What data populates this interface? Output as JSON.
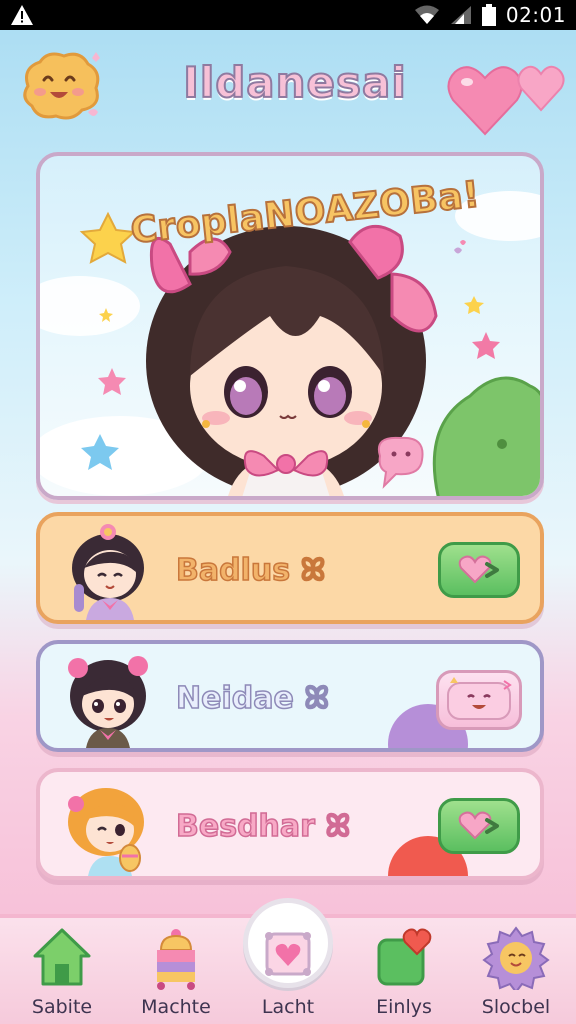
{
  "status_bar": {
    "warning_icon": "warning-triangle-icon",
    "wifi_icon": "wifi-icon",
    "signal_icon": "signal-icon",
    "battery_icon": "battery-icon",
    "time": "02:01"
  },
  "header": {
    "title": "Ildanesai",
    "mascot_icon": "smiling-cookie-icon",
    "hearts_icon": "hearts-icon"
  },
  "hero": {
    "title": "CroplaNOAZOBa!",
    "character": "chibi-girl-with-pink-bows"
  },
  "characters": [
    {
      "name": "Badlus ꕤ",
      "avatar": "chibi-girl-dark-hair-bun",
      "action_icon": "heart-arrow-icon"
    },
    {
      "name": "Neidae ꕤ",
      "avatar": "chibi-girl-pink-bows",
      "action_icon": "happy-pillow-icon"
    },
    {
      "name": "Besdhar ꕤ",
      "avatar": "chibi-girl-orange-hair",
      "action_icon": "heart-arrow-icon"
    }
  ],
  "nav": {
    "items": [
      {
        "label": "Sabite",
        "icon": "home-icon"
      },
      {
        "label": "Machte",
        "icon": "bell-cake-icon"
      },
      {
        "label": "Lacht",
        "icon": "heart-pillow-icon"
      },
      {
        "label": "Einlys",
        "icon": "heart-badge-icon"
      },
      {
        "label": "Slocbel",
        "icon": "sun-face-icon"
      }
    ]
  },
  "colors": {
    "accent_pink": "#f6b8d3",
    "accent_green": "#5bbf60",
    "accent_orange": "#e9a35e",
    "accent_purple": "#9f97c7"
  }
}
